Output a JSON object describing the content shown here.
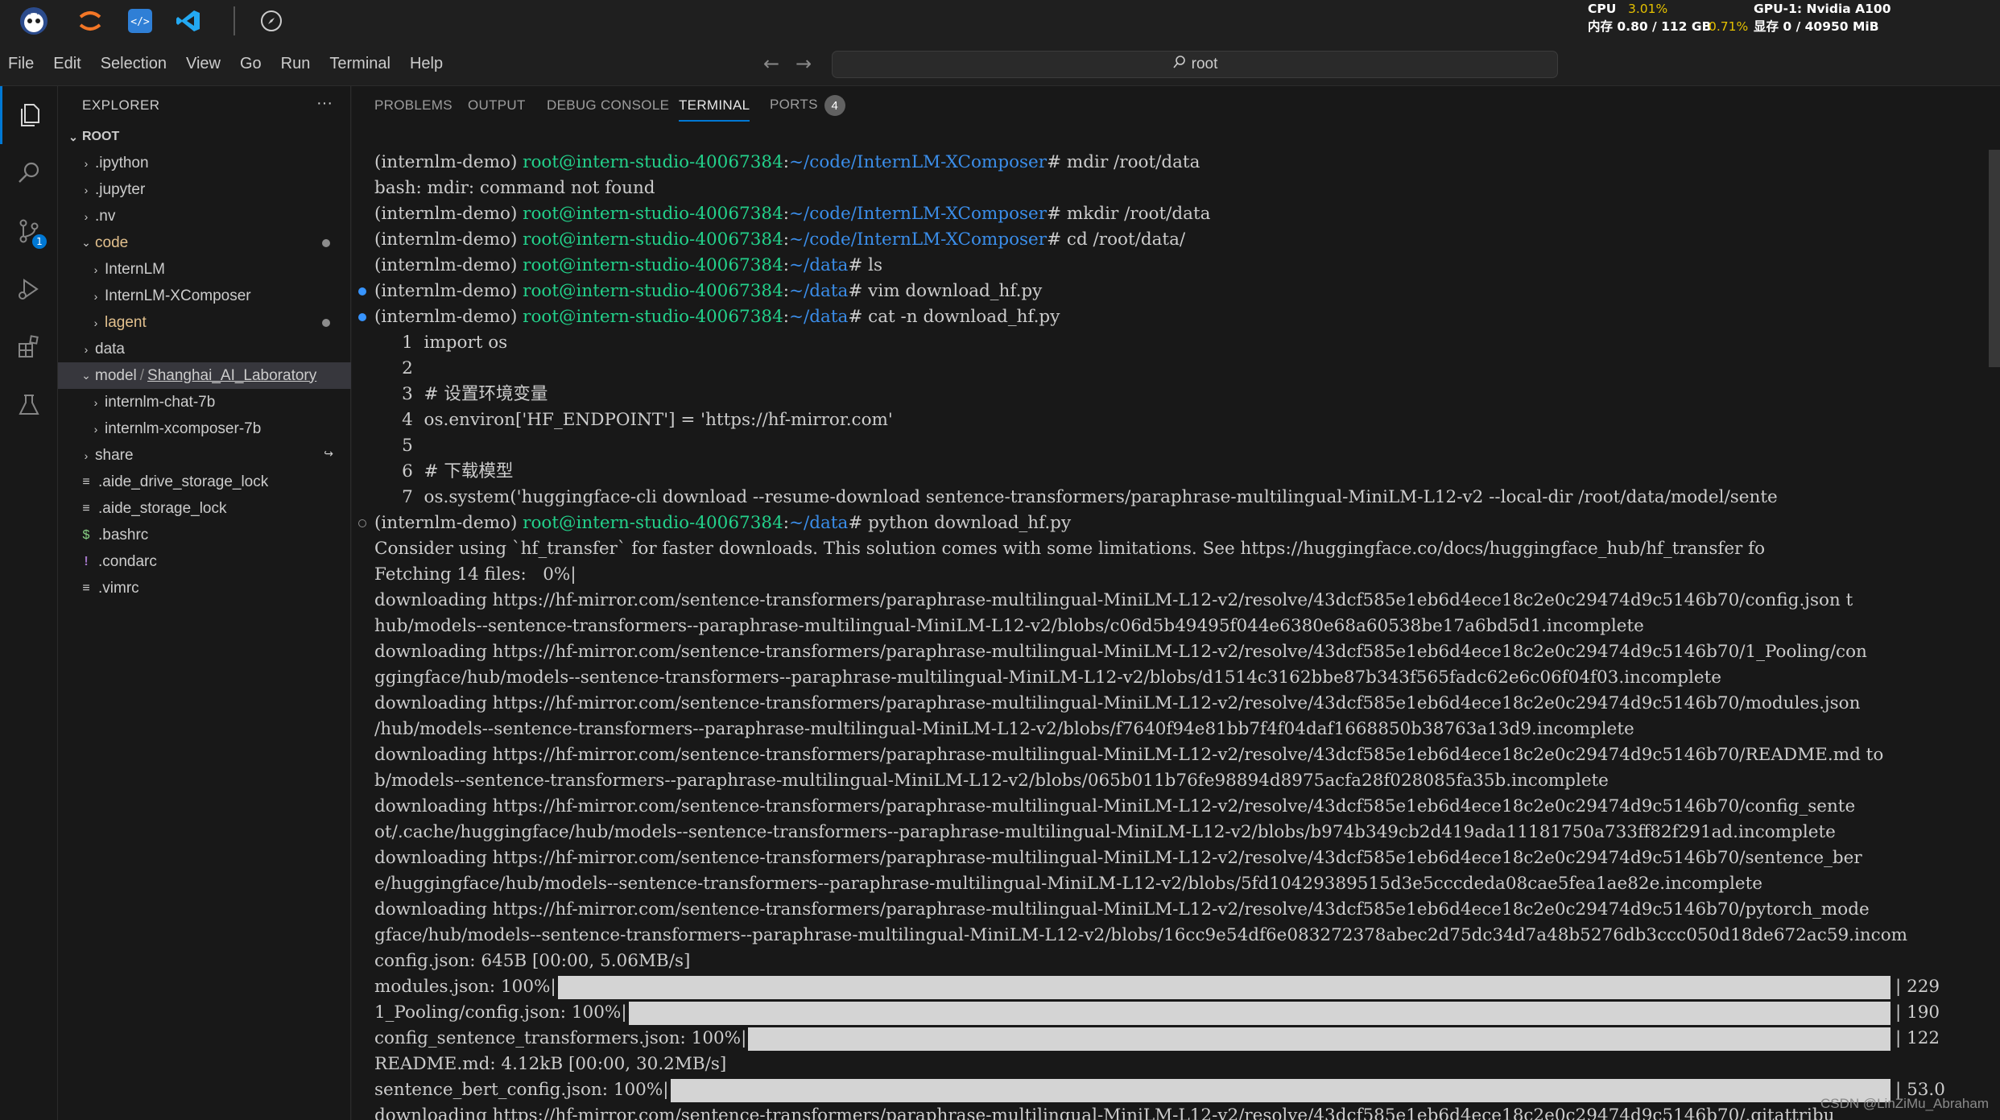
{
  "taskbar": {
    "icons": [
      "mascot-icon",
      "jupyter-icon",
      "code-editor-icon",
      "vscode-icon",
      "compass-icon"
    ],
    "cpu_label": "CPU",
    "cpu_value": "3.01%",
    "mem_label": "内存 0.80 / 112 GB",
    "mem_pct": "0.71%",
    "gpu_label": "GPU-1: Nvidia A100",
    "vram_label": "显存 0 / 40950 MiB"
  },
  "menubar": {
    "items": [
      "File",
      "Edit",
      "Selection",
      "View",
      "Go",
      "Run",
      "Terminal",
      "Help"
    ],
    "search_text": "root"
  },
  "activity": {
    "items": [
      "explorer-icon",
      "search-icon",
      "source-control-icon",
      "run-debug-icon",
      "extensions-icon",
      "testing-icon"
    ],
    "scm_badge": "1"
  },
  "explorer": {
    "title": "EXPLORER",
    "root_label": "ROOT",
    "items": [
      {
        "label": ".ipython"
      },
      {
        "label": ".jupyter"
      },
      {
        "label": ".nv"
      },
      {
        "label": "code"
      },
      {
        "label": "InternLM"
      },
      {
        "label": "InternLM-XComposer"
      },
      {
        "label": "lagent"
      },
      {
        "label": "data"
      },
      {
        "label": "model",
        "sep": "/",
        "sub": "Shanghai_AI_Laboratory"
      },
      {
        "label": "internlm-chat-7b"
      },
      {
        "label": "internlm-xcomposer-7b"
      },
      {
        "label": "share"
      },
      {
        "label": ".aide_drive_storage_lock"
      },
      {
        "label": ".aide_storage_lock"
      },
      {
        "label": ".bashrc"
      },
      {
        "label": ".condarc"
      },
      {
        "label": ".vimrc"
      }
    ]
  },
  "panel": {
    "tabs": [
      "PROBLEMS",
      "OUTPUT",
      "DEBUG CONSOLE",
      "TERMINAL",
      "PORTS"
    ],
    "ports_count": "4",
    "active_tab": "TERMINAL"
  },
  "terminal": {
    "env": "(internlm-demo) ",
    "user": "root@intern-studio-40067384",
    "lines": [
      {
        "kind": "prompt",
        "path": "~/code/InternLM-XComposer",
        "cmd": "# mdir /root/data"
      },
      {
        "kind": "text",
        "text": "bash: mdir: command not found"
      },
      {
        "kind": "prompt",
        "path": "~/code/InternLM-XComposer",
        "cmd": "# mkdir /root/data"
      },
      {
        "kind": "prompt",
        "path": "~/code/InternLM-XComposer",
        "cmd": "# cd /root/data/"
      },
      {
        "kind": "prompt",
        "path": "~/data",
        "cmd": "# ls"
      },
      {
        "kind": "prompt",
        "path": "~/data",
        "cmd": "# vim download_hf.py",
        "marker": "blue"
      },
      {
        "kind": "prompt",
        "path": "~/data",
        "cmd": "# cat -n download_hf.py",
        "marker": "blue"
      },
      {
        "kind": "text",
        "text": "     1  import os"
      },
      {
        "kind": "text",
        "text": "     2"
      },
      {
        "kind": "text",
        "text": "     3  # 设置环境变量"
      },
      {
        "kind": "text",
        "text": "     4  os.environ['HF_ENDPOINT'] = 'https://hf-mirror.com'"
      },
      {
        "kind": "text",
        "text": "     5"
      },
      {
        "kind": "text",
        "text": "     6  # 下载模型"
      },
      {
        "kind": "text",
        "text": "     7  os.system('huggingface-cli download --resume-download sentence-transformers/paraphrase-multilingual-MiniLM-L12-v2 --local-dir /root/data/model/sente"
      },
      {
        "kind": "prompt",
        "path": "~/data",
        "cmd": "# python download_hf.py",
        "marker": "hollow"
      },
      {
        "kind": "text",
        "text": "Consider using `hf_transfer` for faster downloads. This solution comes with some limitations. See https://huggingface.co/docs/huggingface_hub/hf_transfer fo"
      },
      {
        "kind": "text",
        "text": "Fetching 14 files:   0%|"
      },
      {
        "kind": "text",
        "text": "downloading https://hf-mirror.com/sentence-transformers/paraphrase-multilingual-MiniLM-L12-v2/resolve/43dcf585e1eb6d4ece18c2e0c29474d9c5146b70/config.json t"
      },
      {
        "kind": "text",
        "text": "hub/models--sentence-transformers--paraphrase-multilingual-MiniLM-L12-v2/blobs/c06d5b49495f044e6380e68a60538be17a6bd5d1.incomplete"
      },
      {
        "kind": "text",
        "text": "downloading https://hf-mirror.com/sentence-transformers/paraphrase-multilingual-MiniLM-L12-v2/resolve/43dcf585e1eb6d4ece18c2e0c29474d9c5146b70/1_Pooling/con"
      },
      {
        "kind": "text",
        "text": "ggingface/hub/models--sentence-transformers--paraphrase-multilingual-MiniLM-L12-v2/blobs/d1514c3162bbe87b343f565fadc62e6c06f04f03.incomplete"
      },
      {
        "kind": "text",
        "text": "downloading https://hf-mirror.com/sentence-transformers/paraphrase-multilingual-MiniLM-L12-v2/resolve/43dcf585e1eb6d4ece18c2e0c29474d9c5146b70/modules.json"
      },
      {
        "kind": "text",
        "text": "/hub/models--sentence-transformers--paraphrase-multilingual-MiniLM-L12-v2/blobs/f7640f94e81bb7f4f04daf1668850b38763a13d9.incomplete"
      },
      {
        "kind": "text",
        "text": "downloading https://hf-mirror.com/sentence-transformers/paraphrase-multilingual-MiniLM-L12-v2/resolve/43dcf585e1eb6d4ece18c2e0c29474d9c5146b70/README.md to"
      },
      {
        "kind": "text",
        "text": "b/models--sentence-transformers--paraphrase-multilingual-MiniLM-L12-v2/blobs/065b011b76fe98894d8975acfa28f028085fa35b.incomplete"
      },
      {
        "kind": "text",
        "text": "downloading https://hf-mirror.com/sentence-transformers/paraphrase-multilingual-MiniLM-L12-v2/resolve/43dcf585e1eb6d4ece18c2e0c29474d9c5146b70/config_sente"
      },
      {
        "kind": "text",
        "text": "ot/.cache/huggingface/hub/models--sentence-transformers--paraphrase-multilingual-MiniLM-L12-v2/blobs/b974b349cb2d419ada11181750a733ff82f291ad.incomplete"
      },
      {
        "kind": "text",
        "text": "downloading https://hf-mirror.com/sentence-transformers/paraphrase-multilingual-MiniLM-L12-v2/resolve/43dcf585e1eb6d4ece18c2e0c29474d9c5146b70/sentence_ber"
      },
      {
        "kind": "text",
        "text": "e/huggingface/hub/models--sentence-transformers--paraphrase-multilingual-MiniLM-L12-v2/blobs/5fd10429389515d3e5cccdeda08cae5fea1ae82e.incomplete"
      },
      {
        "kind": "text",
        "text": "downloading https://hf-mirror.com/sentence-transformers/paraphrase-multilingual-MiniLM-L12-v2/resolve/43dcf585e1eb6d4ece18c2e0c29474d9c5146b70/pytorch_mode"
      },
      {
        "kind": "text",
        "text": "gface/hub/models--sentence-transformers--paraphrase-multilingual-MiniLM-L12-v2/blobs/16cc9e54df6e083272378abec2d75dc34d7a48b5276db3ccc050d18de672ac59.incom"
      },
      {
        "kind": "text",
        "text": "config.json: 645B [00:00, 5.06MB/s]"
      },
      {
        "kind": "progress",
        "text": "modules.json: 100%|",
        "tail": "| 229",
        "progress": 1.0
      },
      {
        "kind": "progress",
        "text": "1_Pooling/config.json: 100%|",
        "tail": "| 190",
        "progress": 1.0
      },
      {
        "kind": "progress",
        "text": "config_sentence_transformers.json: 100%|",
        "tail": "| 122",
        "progress": 1.0
      },
      {
        "kind": "text",
        "text": "README.md: 4.12kB [00:00, 30.2MB/s]"
      },
      {
        "kind": "progress",
        "text": "sentence_bert_config.json: 100%|",
        "tail": "| 53.0",
        "progress": 1.0
      },
      {
        "kind": "text",
        "text": "downloading https://hf-mirror.com/sentence-transformers/paraphrase-multilingual-MiniLM-L12-v2/resolve/43dcf585e1eb6d4ece18c2e0c29474d9c5146b70/.gitattribu"
      }
    ],
    "watermark": "CSDN @LinZiMu_Abraham"
  }
}
